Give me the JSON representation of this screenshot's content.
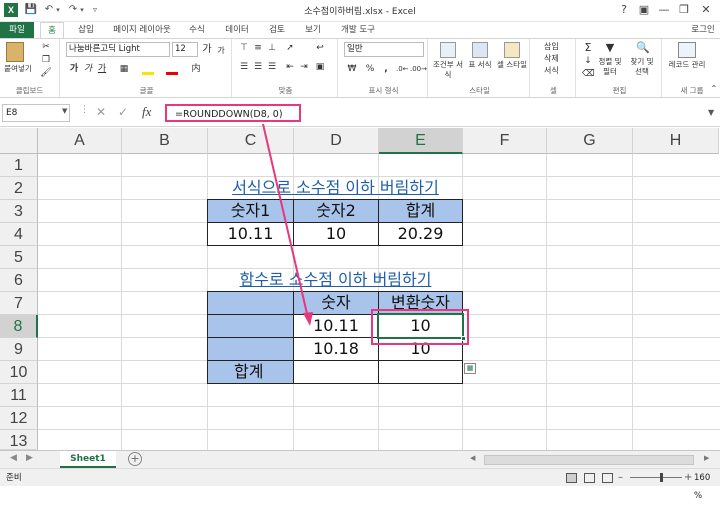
{
  "window": {
    "title": "소수점이하버림.xlsx - Excel",
    "user": "로그인"
  },
  "tabs": [
    {
      "label": "파일"
    },
    {
      "label": "홈"
    },
    {
      "label": "삽입"
    },
    {
      "label": "페이지 레이아웃"
    },
    {
      "label": "수식"
    },
    {
      "label": "데이터"
    },
    {
      "label": "검토"
    },
    {
      "label": "보기"
    },
    {
      "label": "개발 도구"
    }
  ],
  "ribbon": {
    "clipboard": {
      "paste": "붙여넣기",
      "label": "클립보드"
    },
    "font": {
      "name": "나눔바른고딕 Light",
      "size": "12",
      "label": "글꼴",
      "bold": "가",
      "italic": "가",
      "underline": "가",
      "grow": "가",
      "shrink": "가"
    },
    "align": {
      "label": "맞춤"
    },
    "number": {
      "format": "일반",
      "percent": "%",
      "comma": ",",
      "label": "표시 형식"
    },
    "styles": {
      "cond": "조건부 서식",
      "table": "표 서식",
      "cell": "셀 스타일",
      "label": "스타일"
    },
    "cells": {
      "insert": "삽입",
      "delete": "삭제",
      "format": "서식",
      "label": "셀"
    },
    "editing": {
      "sort": "정렬 및 필터",
      "find": "찾기 및 선택",
      "label": "편집"
    },
    "macro": {
      "record": "레코드 관리",
      "label": "새 그룹"
    }
  },
  "formula_bar": {
    "name_box": "E8",
    "formula": "=ROUNDDOWN(D8, 0)"
  },
  "columns": [
    "A",
    "B",
    "C",
    "D",
    "E",
    "F",
    "G",
    "H"
  ],
  "rows": [
    "1",
    "2",
    "3",
    "4",
    "5",
    "6",
    "7",
    "8",
    "9",
    "10",
    "11",
    "12",
    "13"
  ],
  "sheet": {
    "title1": "서식으로 소수점 이하 버림하기",
    "table1": {
      "headers": [
        "숫자1",
        "숫자2",
        "합계"
      ],
      "values": [
        "10.11",
        "10",
        "20.29"
      ]
    },
    "title2": "함수로 소수점 이하 버림하기",
    "table2": {
      "header_num": "숫자",
      "header_conv": "변환숫자",
      "r8_num": "10.11",
      "r8_conv": "10",
      "r9_num": "10.18",
      "r9_conv": "10",
      "total": "합계"
    }
  },
  "sheet_tabs": {
    "active": "Sheet1",
    "add": "+"
  },
  "status": {
    "mode": "준비",
    "zoom": "160 %"
  },
  "colors": {
    "excel_green": "#217346",
    "highlight": "#e8377f",
    "header_fill": "#a9c4ea",
    "link": "#1f5fa8"
  }
}
